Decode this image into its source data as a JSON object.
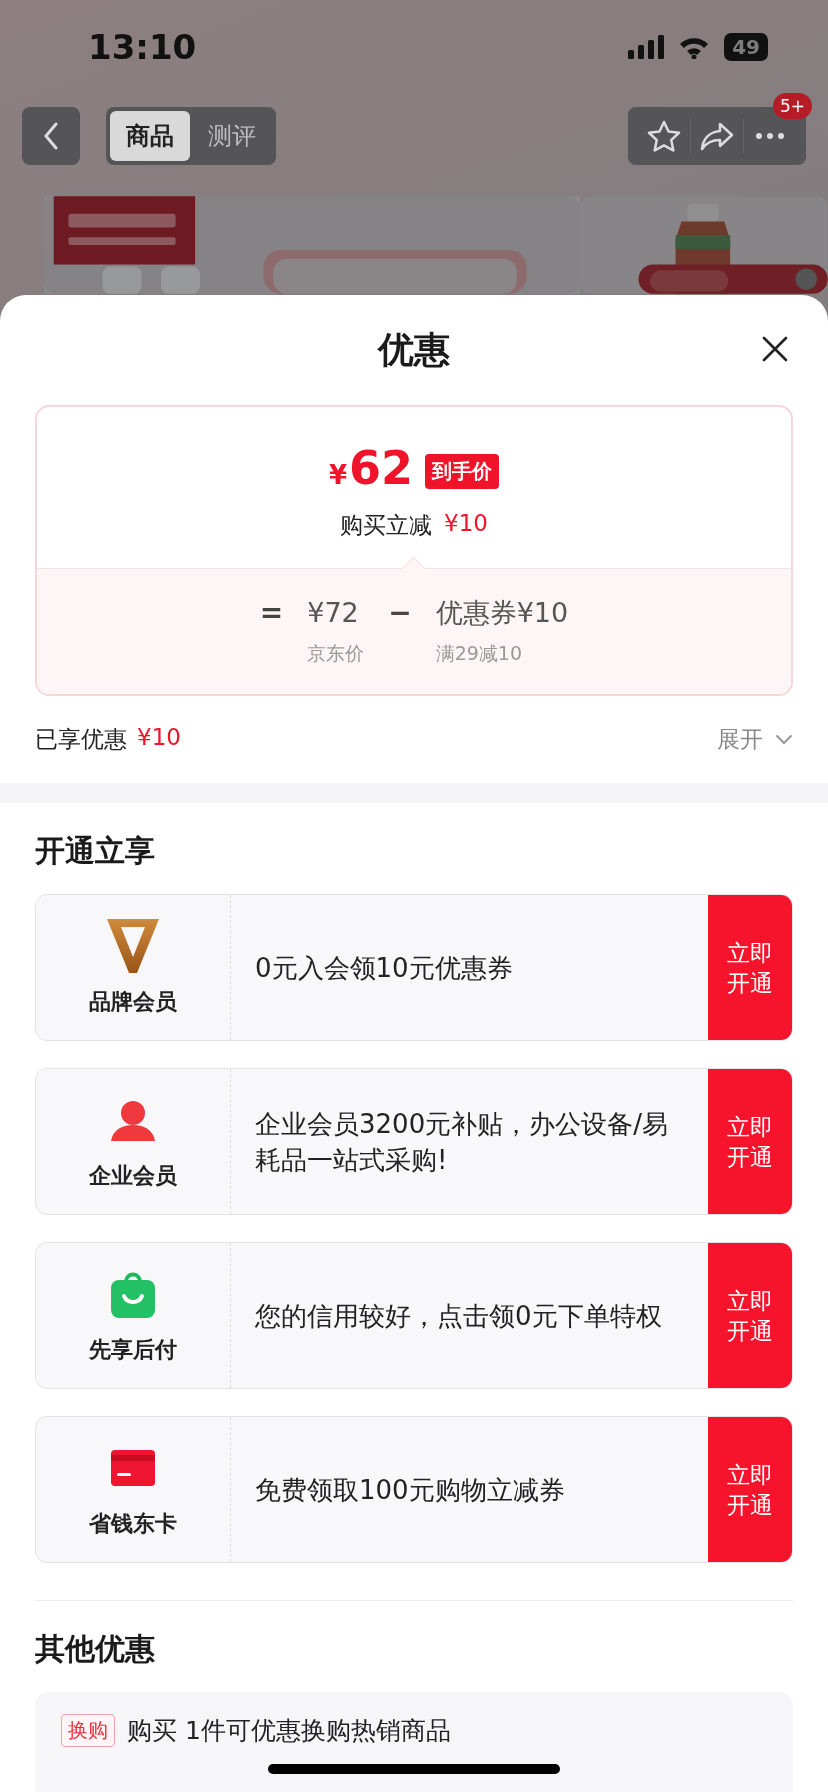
{
  "status_bar": {
    "time": "13:10",
    "battery": "49"
  },
  "nav": {
    "tabs": [
      {
        "label": "商品",
        "selected": true
      },
      {
        "label": "测评",
        "selected": false
      }
    ],
    "badge": "5+"
  },
  "sheet": {
    "title": "优惠"
  },
  "price_card": {
    "currency": "¥",
    "price": "62",
    "price_tag": "到手价",
    "saving_label": "购买立减",
    "saving_amount": "¥10",
    "equals": "=",
    "original_price": "¥72",
    "minus": "−",
    "coupon": "优惠券¥10",
    "original_label": "京东价",
    "coupon_rule": "满29减10"
  },
  "enjoyed": {
    "label": "已享优惠",
    "amount": "¥10",
    "toggle": "展开",
    "expanded": false
  },
  "open_section": {
    "title": "开通立享",
    "offers": [
      {
        "kind": "brand",
        "name": "品牌会员",
        "text": "0元入会领10元优惠券",
        "button": "立即开通"
      },
      {
        "kind": "enterprise",
        "name": "企业会员",
        "text": "企业会员3200元补贴，办公设备/易耗品一站式采购!",
        "button": "立即开通"
      },
      {
        "kind": "paylater",
        "name": "先享后付",
        "text": "您的信用较好，点击领0元下单特权",
        "button": "立即开通"
      },
      {
        "kind": "card",
        "name": "省钱东卡",
        "text": "免费领取100元购物立减券",
        "button": "立即开通"
      }
    ]
  },
  "other_section": {
    "title": "其他优惠",
    "items": [
      {
        "tag": "换购",
        "text": "购买 1件可优惠换购热销商品"
      }
    ]
  }
}
